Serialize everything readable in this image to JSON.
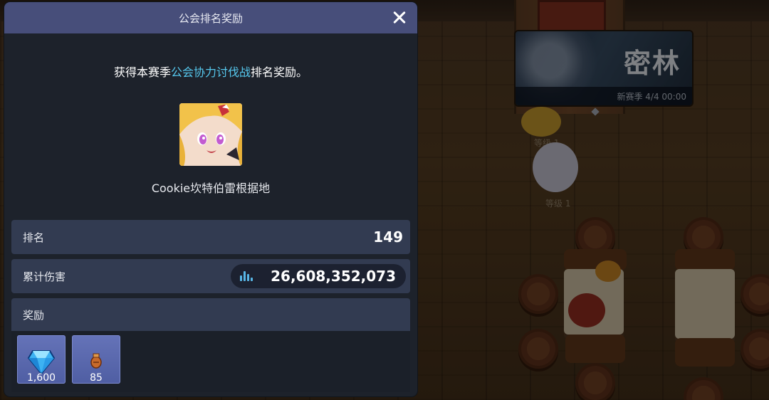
{
  "scene": {
    "banner_title": "密林",
    "banner_caption": "新赛季 4/4 00:00",
    "npc_labels": [
      "等级 1",
      "等级 1"
    ]
  },
  "panel": {
    "title": "公会排名奖励",
    "intro_prefix": "获得本赛季",
    "intro_highlight": "公会协力讨伐战",
    "intro_suffix": "排名奖励。",
    "guild_name": "Cookie坎特伯雷根据地",
    "rank_label": "排名",
    "rank_value": "149",
    "damage_label": "累计伤害",
    "damage_value": "26,608,352,073",
    "reward_label": "奖励",
    "rewards": [
      {
        "icon": "crystal-gem-icon",
        "count": "1,600"
      },
      {
        "icon": "item-pouch-icon",
        "count": "85"
      }
    ]
  },
  "colors": {
    "header": "#474e7a",
    "highlight": "#56c8ee",
    "row": "#323b51",
    "panel": "#1d222b"
  }
}
